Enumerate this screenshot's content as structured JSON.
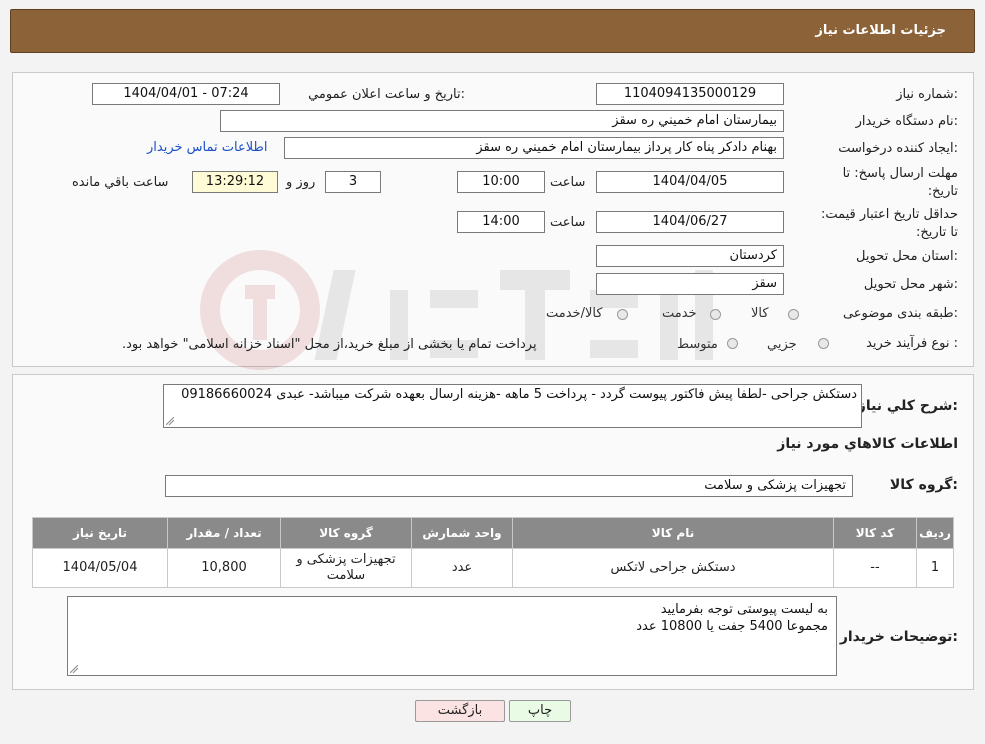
{
  "header": {
    "title": "جزئيات اطلاعات نياز"
  },
  "form": {
    "need_number_label": "شماره نياز:",
    "need_number": "1104094135000129",
    "announce_label": "تاريخ و ساعت اعلان عمومي:",
    "announce_value": "1404/04/01 - 07:24",
    "buyer_org_label": "نام دستگاه خريدار:",
    "buyer_org": "بيمارستان امام خميني  ره  سقز",
    "creator_label": "ايجاد کننده درخواست:",
    "creator": "بهنام دادکر پناه کار پرداز بيمارستان امام خميني  ره  سقز",
    "contact_link": "اطلاعات تماس خريدار",
    "deadline_label": "مهلت ارسال پاسخ: تا تاريخ:",
    "deadline_date": "1404/04/05",
    "time_label": "ساعت",
    "deadline_time": "10:00",
    "days_value": "3",
    "days_label": "روز و",
    "remaining_time": "13:29:12",
    "remaining_label": "ساعت باقي مانده",
    "validity_label": "حداقل تاريخ اعتبار قيمت: تا تاريخ:",
    "validity_date": "1404/06/27",
    "validity_time": "14:00",
    "province_label": "استان محل تحويل:",
    "province": "کردستان",
    "city_label": "شهر محل تحويل:",
    "city": "سقز",
    "category_label": "طبقه بندی موضوعی:",
    "category_options": [
      "کالا",
      "خدمت",
      "کالا/خدمت"
    ],
    "process_label": "نوع فرآيند خريد :",
    "process_options": [
      "جزيي",
      "متوسط"
    ],
    "process_note": "پرداخت تمام يا بخشی از مبلغ خريد،از محل \"اسناد خزانه اسلامی\" خواهد بود."
  },
  "description": {
    "label": "شرح کلي نياز:",
    "text": "دستکش جراحی -لطفا پیش فاکتور پیوست گردد - پرداخت 5 ماهه -هزینه ارسال بعهده شرکت میباشد- عبدی 09186660024"
  },
  "goods": {
    "section_title": "اطلاعات کالاهاي مورد نياز",
    "group_label": "گروه کالا:",
    "group_value": "تجهيزات پزشکی و سلامت",
    "columns": [
      "رديف",
      "کد کالا",
      "نام کالا",
      "واحد شمارش",
      "گروه کالا",
      "تعداد / مقدار",
      "تاريخ نياز"
    ],
    "rows": [
      {
        "index": "1",
        "code": "--",
        "name": "دستکش جراحی لاتکس",
        "unit": "عدد",
        "group": "تجهيزات پزشکی و سلامت",
        "qty": "10,800",
        "date": "1404/05/04"
      }
    ]
  },
  "buyer_notes": {
    "label": "توضيحات خريدار:",
    "line1": "به لیست پیوستی توجه بفرمایید",
    "line2": "مجموعا 5400 جفت   یا  10800 عدد"
  },
  "buttons": {
    "print": "چاپ",
    "back": "بازگشت"
  },
  "colors": {
    "header": "#8c6239",
    "table_header": "#8a8a8a",
    "link": "#1a4fc9",
    "print_btn": "#e9fbe4",
    "back_btn": "#fbe3e3"
  }
}
